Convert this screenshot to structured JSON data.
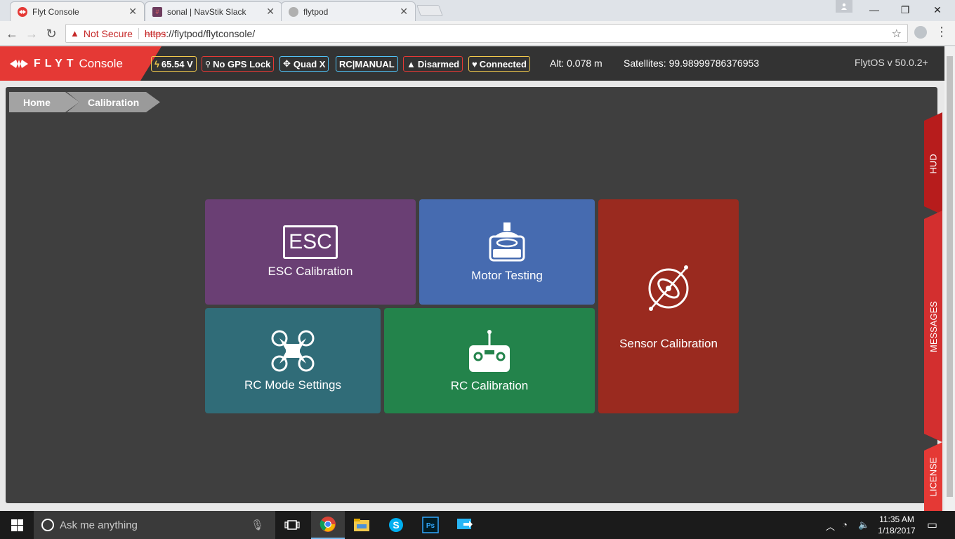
{
  "browser": {
    "tabs": [
      {
        "title": "Flyt Console",
        "active": true
      },
      {
        "title": "sonal | NavStik Slack",
        "active": false
      },
      {
        "title": "flytpod",
        "active": false
      }
    ],
    "address": {
      "security_label": "Not Secure",
      "url_scheme": "https",
      "url_rest": "://flytpod/flytconsole/"
    }
  },
  "app": {
    "brand_flyt": "FLYT",
    "brand_console": "Console",
    "status": {
      "battery": "65.54 V",
      "gps": "No GPS Lock",
      "frame": "Quad X",
      "mode": "RC|MANUAL",
      "arm": "Disarmed",
      "connection": "Connected",
      "altitude": "Alt: 0.078 m",
      "satellites": "Satellites: 99.98999786376953",
      "version": "FlytOS v 50.0.2+"
    },
    "colors": {
      "brand": "#e53935",
      "battery": "#f2c94c",
      "gps": "#e53935",
      "frame": "#4fc3f7",
      "mode": "#4fc3f7",
      "arm": "#e53935",
      "connection": "#f2c94c"
    }
  },
  "breadcrumb": {
    "home": "Home",
    "current": "Calibration"
  },
  "tiles": {
    "esc": {
      "icon_text": "ESC",
      "label": "ESC Calibration",
      "icon": "esc-icon"
    },
    "motor": {
      "label": "Motor Testing",
      "icon": "motor-icon"
    },
    "sensor": {
      "label": "Sensor Calibration",
      "icon": "gyro-icon"
    },
    "rc_mode": {
      "label": "RC Mode Settings",
      "icon": "quadcopter-icon"
    },
    "rc_cal": {
      "label": "RC Calibration",
      "icon": "remote-control-icon"
    }
  },
  "side_tabs": {
    "hud": "HUD",
    "messages": "MESSAGES",
    "license": "LICENSE"
  },
  "taskbar": {
    "search_placeholder": "Ask me anything",
    "time": "11:35 AM",
    "date": "1/18/2017"
  }
}
